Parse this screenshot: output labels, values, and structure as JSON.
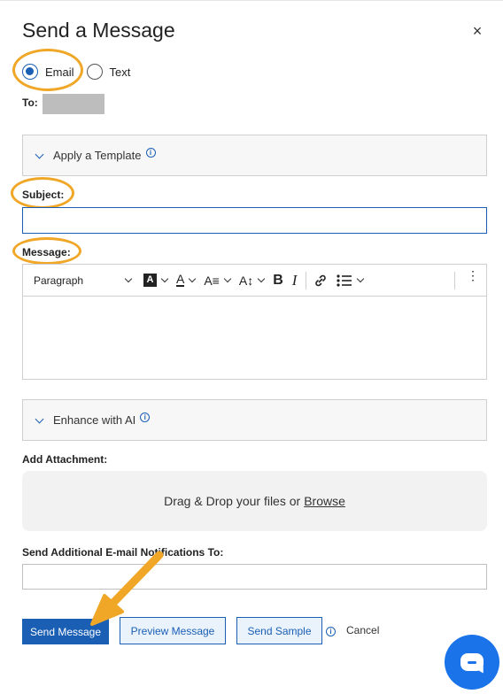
{
  "dialog": {
    "title": "Send a Message",
    "close_glyph": "×"
  },
  "message_type": {
    "options": [
      {
        "label": "Email",
        "checked": true
      },
      {
        "label": "Text",
        "checked": false
      }
    ]
  },
  "to": {
    "label": "To:"
  },
  "template": {
    "label": "Apply a Template",
    "info_icon": "info-icon"
  },
  "subject": {
    "label": "Subject:",
    "value": ""
  },
  "message": {
    "label": "Message:",
    "toolbar": {
      "paragraph_label": "Paragraph",
      "bold": "B",
      "italic": "I",
      "icons": [
        "background-color-icon",
        "text-color-icon",
        "font-size-icon",
        "line-height-icon",
        "bold-icon",
        "italic-icon",
        "link-icon",
        "bulleted-list-icon",
        "more-options-icon"
      ]
    },
    "value": ""
  },
  "enhance": {
    "label": "Enhance with AI"
  },
  "attachment": {
    "label": "Add Attachment:",
    "drop_text": "Drag & Drop your files or",
    "browse_label": "Browse"
  },
  "notifications": {
    "label": "Send Additional E-mail Notifications To:",
    "value": ""
  },
  "actions": {
    "send_label": "Send Message",
    "preview_label": "Preview Message",
    "sample_label": "Send Sample",
    "cancel_label": "Cancel"
  },
  "colors": {
    "primary": "#1a5fb4",
    "highlight": "#f0a626",
    "chat": "#1a73e8"
  }
}
